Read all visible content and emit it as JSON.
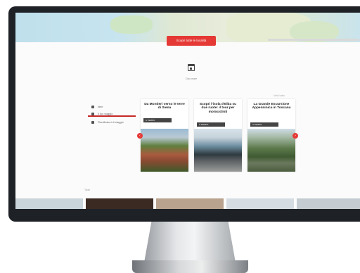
{
  "hero": {
    "cta_label": "Scopri tutte le località"
  },
  "calendar": {
    "label": "Ciao mare"
  },
  "nav": {
    "items": [
      "Idee",
      "Il tuo viaggio",
      "Pianificatori di viaggio"
    ]
  },
  "section": {
    "see_all": "Vedi tutto"
  },
  "cards": [
    {
      "title": "Da Montieri verso le terre di Siena",
      "tag": "A TEMPO"
    },
    {
      "title": "Scopri l'isola d'Elba su due ruote: il tour per motociclisti",
      "tag": "A TEMPO"
    },
    {
      "title": "La Grande Escursione Appenninica in Toscana",
      "tag": "A TEMPO"
    }
  ],
  "carousel": {
    "prev_icon": "‹",
    "next_icon": "›"
  },
  "bottom": {
    "label": "Tipici"
  },
  "colors": {
    "accent": "#e53935",
    "frame": "#1e2126"
  }
}
